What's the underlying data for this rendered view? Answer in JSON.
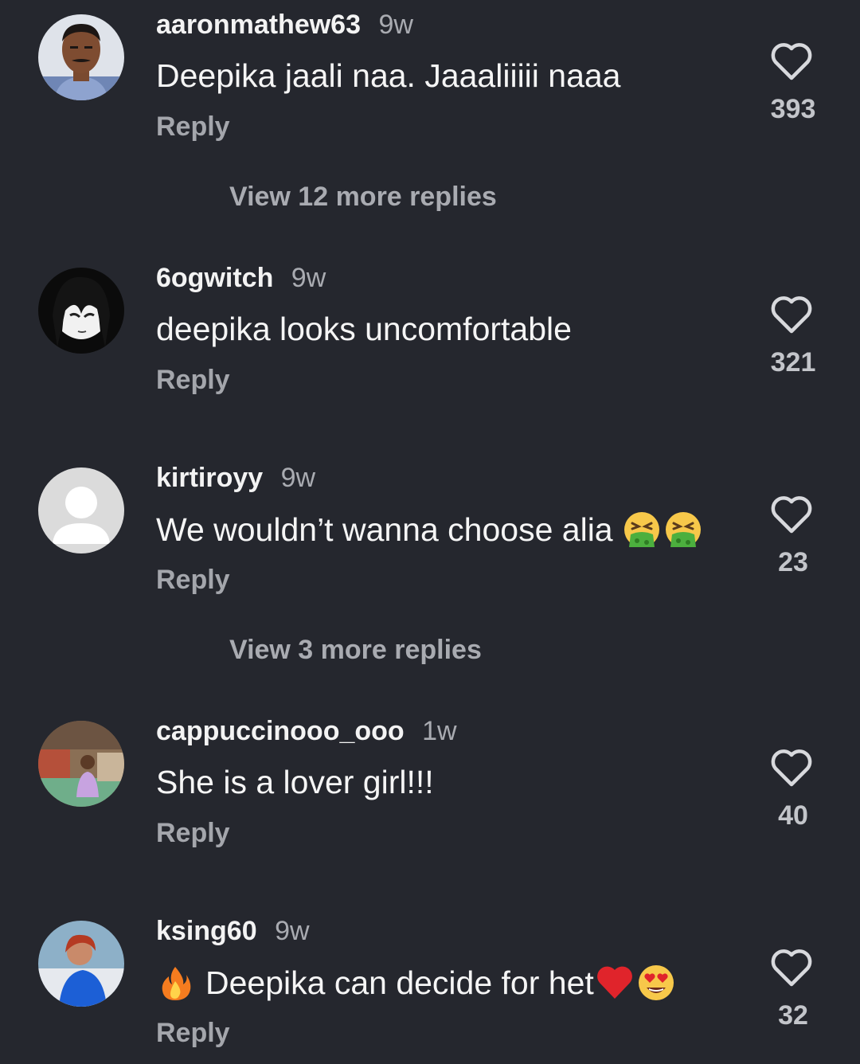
{
  "colors": {
    "background": "#25272e",
    "text_primary": "#f5f5f5",
    "text_secondary": "#a9abb1",
    "emoji_heart": "#e0242b"
  },
  "comments": [
    {
      "username": "aaronmathew63",
      "time": "9w",
      "text": "Deepika jaali naa. Jaaaliiiii naaa",
      "reply_label": "Reply",
      "likes": "393",
      "more_replies": "View 12 more replies",
      "avatar_icon": "man-photo-avatar"
    },
    {
      "username": "6ogwitch",
      "time": "9w",
      "text": "deepika looks uncomfortable",
      "reply_label": "Reply",
      "likes": "321",
      "avatar_icon": "anime-girl-avatar"
    },
    {
      "username": "kirtiroyy",
      "time": "9w",
      "text": "We wouldn’t wanna choose alia",
      "emojis": [
        "vomiting-face-emoji",
        "vomiting-face-emoji"
      ],
      "reply_label": "Reply",
      "likes": "23",
      "more_replies": "View 3 more replies",
      "avatar_icon": "default-user-avatar"
    },
    {
      "username": "cappuccinooo_ooo",
      "time": "1w",
      "text": "She is a lover girl!!!",
      "reply_label": "Reply",
      "likes": "40",
      "avatar_icon": "woman-photo-avatar"
    },
    {
      "username": "ksing60",
      "time": "9w",
      "text": "Deepika can decide for het",
      "leading_emoji": "fire-emoji",
      "emojis": [
        "red-heart-emoji",
        "heart-eyes-emoji"
      ],
      "reply_label": "Reply",
      "likes": "32",
      "avatar_icon": "woman-blue-photo-avatar"
    }
  ]
}
